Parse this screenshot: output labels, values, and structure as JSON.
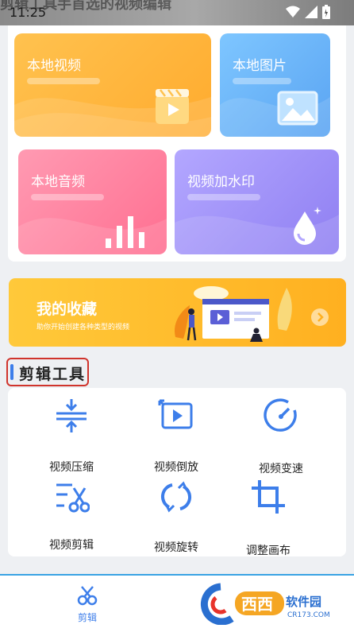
{
  "status_bar": {
    "time": "11:25",
    "banner_text": "剪辑工具手首选的视频编辑"
  },
  "cards": [
    {
      "title": "本地视频",
      "icon": "video-file-icon"
    },
    {
      "title": "本地图片",
      "icon": "image-icon"
    },
    {
      "title": "本地音频",
      "icon": "audio-bars-icon"
    },
    {
      "title": "视频加水印",
      "icon": "water-drop-icon"
    }
  ],
  "favorites": {
    "title": "我的收藏",
    "subtitle": "助你开始创建各种类型的视频",
    "icon": "chevron-right-icon"
  },
  "section": {
    "title": "剪辑工具",
    "accent_color": "#3d7eea",
    "highlight_color": "#d0342c"
  },
  "tools": [
    {
      "label": "视频压缩",
      "icon": "compress-icon"
    },
    {
      "label": "视频倒放",
      "icon": "reverse-play-icon"
    },
    {
      "label": "视频变速",
      "icon": "speed-gauge-icon"
    },
    {
      "label": "视频剪辑",
      "icon": "scissors-icon"
    },
    {
      "label": "视频旋转",
      "icon": "rotate-icon"
    },
    {
      "label": "调整画布",
      "icon": "crop-icon"
    }
  ],
  "bottom_nav": {
    "items": [
      {
        "label": "剪辑",
        "icon": "scissors-icon",
        "active": true
      }
    ]
  },
  "watermark": {
    "brand": "西西",
    "brand_sub": "软件园",
    "domain": "CR173.COM"
  },
  "colors": {
    "primary": "#3d7eea",
    "card_orange": "#ffb030",
    "card_blue": "#62adf5",
    "card_pink": "#ff7c9b",
    "card_purple": "#9c8dfa",
    "banner_yellow": "#ffbf2e"
  }
}
